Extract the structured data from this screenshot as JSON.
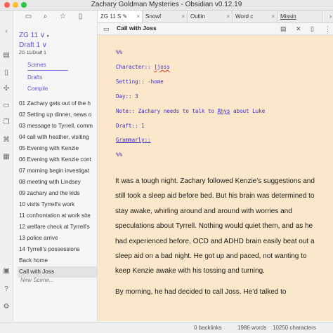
{
  "window": {
    "title": "Zachary Goldman Mysteries - Obsidian v0.12.19"
  },
  "sidebar": {
    "project": "ZG 11",
    "draft": "Draft 1",
    "draft_path": "ZG 11/Draft 1",
    "tabs": {
      "scenes": "Scenes",
      "drafts": "Drafts",
      "compile": "Compile"
    },
    "scenes": [
      "01 Zachary gets out of the h",
      "02 Setting up dinner, news o",
      "03 message to Tyrrell, comm",
      "04 call with heather, visiting",
      "05 Evening with Kenzie",
      "06 Evening with Kenzie cont",
      "07 morning begin investigat",
      "08 meeting with Lindsey",
      "09 zachary and the kids",
      "10 visits Tyrrell's work",
      "11 confrontation at work site",
      "12 welfare check at Tyrrell's",
      "13 police arrive",
      "14 Tyrrell's possessions",
      "Back home",
      "Call with Joss"
    ],
    "new_scene_placeholder": "New Scene..."
  },
  "tabs": [
    {
      "label": "ZG 11 S"
    },
    {
      "label": "Snowf"
    },
    {
      "label": "Outlin"
    },
    {
      "label": "Word c"
    },
    {
      "label": "Missin"
    }
  ],
  "view": {
    "title": "Call with Joss"
  },
  "frontmatter": {
    "open": "%%",
    "character_key": "Character:: ",
    "character_val": "[joss",
    "setting": "Setting:: -home",
    "day": "Day:: 3",
    "note_pre": "Note:: Zachary needs to talk to ",
    "note_name": "Rhys",
    "note_post": " about Luke",
    "draft": "Draft:: 1",
    "grammarly": "Grammarly::",
    "close": "%%"
  },
  "body": {
    "p1": "It was a tough night. Zachary followed Kenzie’s suggestions and still took a sleep aid before bed. But his brain was determined to stay awake, whirling around and around with worries and speculations about Tyrrell. Nothing would quiet them, and as he had experienced before, OCD and ADHD brain easily beat out a sleep aid on a bad night. He got up and paced, not wanting to keep Kenzie awake with his tossing and turning.",
    "p2": "By morning, he had decided to call Joss. He’d talked to"
  },
  "status": {
    "backlinks": "0 backlinks",
    "words": "1986 words",
    "characters": "10250 characters"
  },
  "icons": {
    "ribbon": [
      "chevron-left-icon",
      "calendar-icon",
      "file-icon",
      "graph-icon",
      "terminal-icon",
      "copy-icon",
      "command-icon",
      "box-icon",
      "help-icon",
      "settings-icon"
    ]
  },
  "colors": {
    "accent": "#6a4fd0",
    "editor_bg": "#fbe7c9",
    "frontmatter": "#3d2ec8"
  }
}
